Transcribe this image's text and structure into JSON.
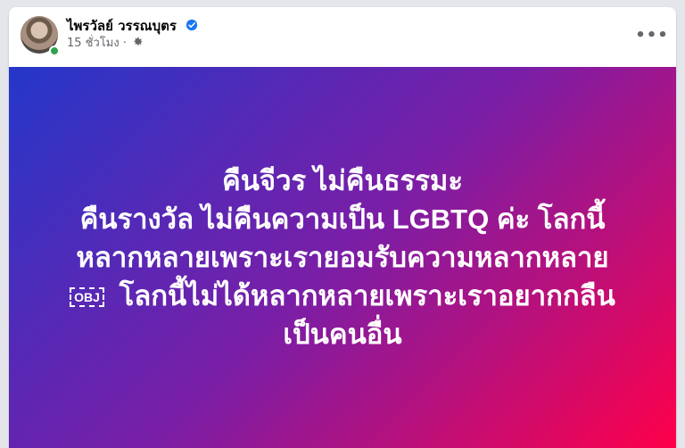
{
  "post": {
    "author": "ไพรวัลย์ วรรณบุตร",
    "time": "15 ชั่วโมง",
    "separator": "·",
    "more_label": "•••",
    "text": {
      "line_1": "คืนจีวร ไม่คืนธรรมะ",
      "line_2": "คืนรางวัล ไม่คืนความเป็น LGBTQ ค่ะ โลกนี้",
      "line_3": "หลากหลายเพราะเรายอมรับความหลากหลาย",
      "line_4_symbol": "OBJ",
      "line_4": "โลกนี้ไม่ได้หลากหลายเพราะเราอยากกลืน",
      "line_5": "เป็นคนอื่น"
    }
  },
  "icons": {
    "verified": "verified-badge-icon",
    "audience": "gear-icon",
    "more": "more-options-icon"
  },
  "colors": {
    "background": "#e4e6eb",
    "card": "#ffffff",
    "verified": "#1877f2",
    "online": "#31a24c",
    "gradient_start": "#2437ca",
    "gradient_middle": "#7b1ea6",
    "gradient_end": "#ff004a"
  }
}
